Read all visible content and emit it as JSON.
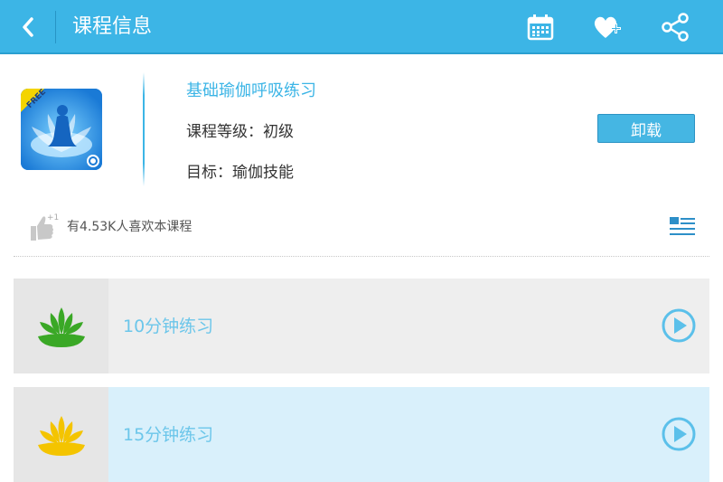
{
  "header": {
    "title": "课程信息",
    "back_icon": "chevron-left-icon",
    "actions": [
      "calendar-icon",
      "heart-plus-icon",
      "share-icon"
    ],
    "color": "#3cb5e6"
  },
  "course": {
    "badge": "FREE",
    "name": "基础瑜伽呼吸练习",
    "level": "课程等级：初级",
    "goal": "目标：瑜伽技能",
    "uninstall_label": "卸载"
  },
  "likes": {
    "plus_one": "+1",
    "text": "有4.53K人喜欢本课程"
  },
  "sessions": [
    {
      "label": "10分钟练习",
      "icon": "lotus-green-icon",
      "icon_color": "#3aa826"
    },
    {
      "label": "15分钟练习",
      "icon": "lotus-yellow-icon",
      "icon_color": "#f4c400"
    }
  ]
}
